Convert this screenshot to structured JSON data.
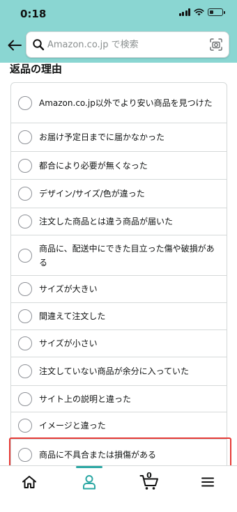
{
  "status_bar": {
    "time": "0:18"
  },
  "header": {
    "search_placeholder": "Amazon.co.jp で検索",
    "icons": [
      "back-arrow-icon",
      "search-icon",
      "camera-scan-icon"
    ]
  },
  "section_title": "返品の理由",
  "options": [
    {
      "label": "Amazon.co.jp以外でより安い商品を見つけた"
    },
    {
      "label": "お届け予定日までに届かなかった"
    },
    {
      "label": "都合により必要が無くなった"
    },
    {
      "label": "デザイン/サイズ/色が違った"
    },
    {
      "label": "注文した商品とは違う商品が届いた"
    },
    {
      "label": "商品に、配送中にできた目立った傷や破損がある"
    },
    {
      "label": "サイズが大きい"
    },
    {
      "label": "間違えて注文した"
    },
    {
      "label": "サイズが小さい"
    },
    {
      "label": "注文していない商品が余分に入っていた"
    },
    {
      "label": "サイト上の説明と違った"
    },
    {
      "label": "イメージと違った"
    },
    {
      "label": "商品に不具合または損傷がある"
    }
  ],
  "bottom_nav": {
    "items": [
      "home-icon",
      "account-icon",
      "cart-icon",
      "menu-icon"
    ],
    "active": "account-icon",
    "cart_count": "0"
  },
  "colors": {
    "header_bg": "#8ad6d2",
    "active_accent": "#2aa7a3",
    "highlight": "#e53935"
  }
}
